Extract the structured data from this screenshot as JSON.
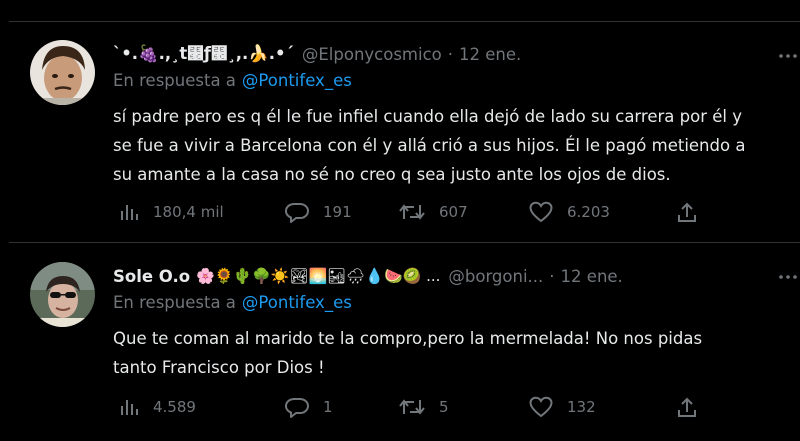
{
  "tweets": [
    {
      "name": "`•.🍇.,¸t⹬ƒ⹬¸,.🍌.•´",
      "emojis": "",
      "handle": "@Elponycosmico",
      "dot": "·",
      "date": "12 ene.",
      "reply_prefix": "En respuesta a",
      "reply_mention": "@Pontifex_es",
      "lines": [
        "sí padre pero es q él le fue infiel cuando ella dejó de lado su carrera por él y",
        "se fue a vivir a Barcelona con él y allá crió a sus hijos. Él le pagó metiendo a",
        "su amante a la casa no sé no creo q sea justo ante los ojos de dios."
      ],
      "views": "180,4 mil",
      "replies": "191",
      "retweets": "607",
      "likes": "6.203",
      "more_icon": "more-dots-icon"
    },
    {
      "name": "Sole O.o",
      "emojis": "🌸🌻🌵🌳☀️🏞🌅🏜🌧💧🍉🥝 ...",
      "handle": "@borgoni...",
      "dot": "·",
      "date": "12 ene.",
      "reply_prefix": "En respuesta a",
      "reply_mention": "@Pontifex_es",
      "lines": [
        "Que te coman al marido te la compro,pero la mermelada! No nos pidas",
        "tanto Francisco por Dios !"
      ],
      "views": "4.589",
      "replies": "1",
      "retweets": "5",
      "likes": "132",
      "more_icon": "more-dots-icon"
    }
  ],
  "colors": {
    "background": "#000000",
    "text": "#e7e9ea",
    "muted": "#71767b",
    "link": "#1d9bf0",
    "divider": "#2f3336"
  }
}
